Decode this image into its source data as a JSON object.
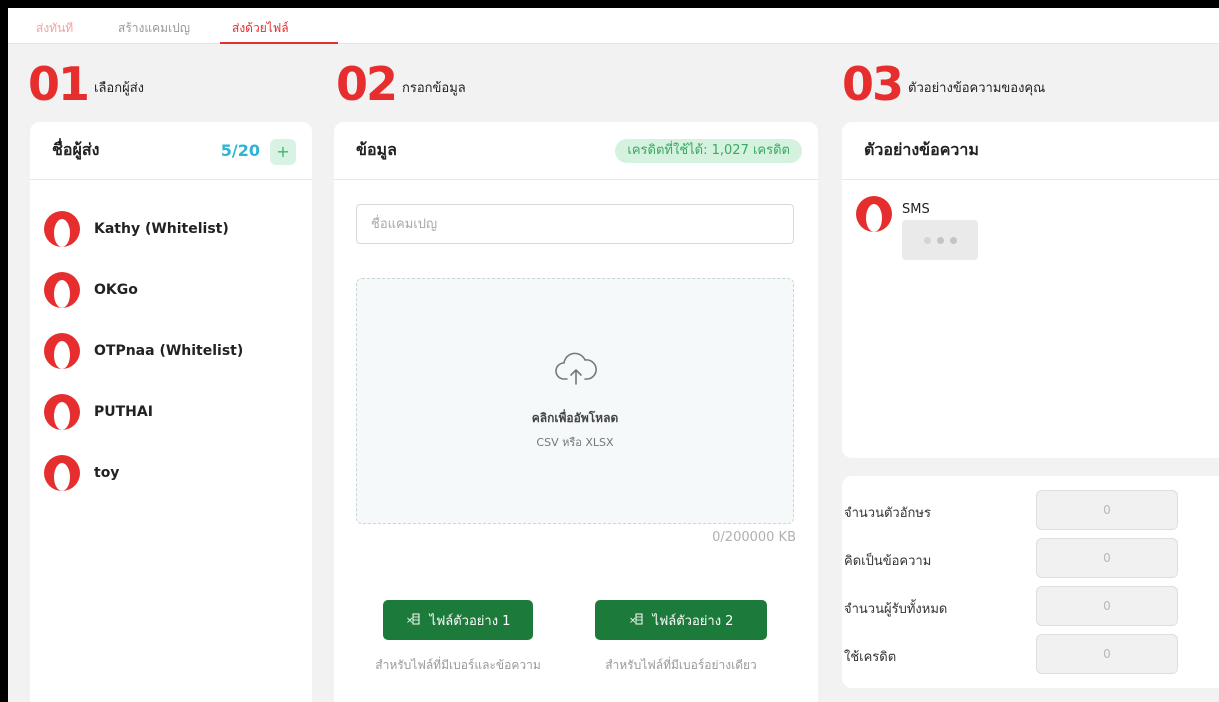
{
  "tabs": [
    {
      "label": "ส่งทันที"
    },
    {
      "label": "สร้างแคมเปญ"
    },
    {
      "label": "ส่งด้วยไฟล์"
    }
  ],
  "steps": [
    {
      "number": "01",
      "label": "เลือกผู้ส่ง"
    },
    {
      "number": "02",
      "label": "กรอกข้อมูล"
    },
    {
      "number": "03",
      "label": "ตัวอย่างข้อความของคุณ"
    }
  ],
  "sender_card": {
    "title": "ชื่อผู้ส่ง",
    "count": "5/20",
    "add_label": "+",
    "senders": [
      {
        "name": "Kathy (Whitelist)"
      },
      {
        "name": "OKGo"
      },
      {
        "name": "OTPnaa (Whitelist)"
      },
      {
        "name": "PUTHAI"
      },
      {
        "name": "toy"
      }
    ]
  },
  "form_card": {
    "title": "ข้อมูล",
    "credit_badge": "เครดิตที่ใช้ได้: 1,027 เครดิต",
    "campaign_placeholder": "ชื่อแคมเปญ",
    "upload_title": "คลิกเพื่ออัพโหลด",
    "upload_sub": "CSV หรือ XLSX",
    "file_size": "0/200000 KB",
    "download_buttons": [
      {
        "label": "ไฟล์ตัวอย่าง 1",
        "note": "สำหรับไฟล์ที่มีเบอร์และข้อความ"
      },
      {
        "label": "ไฟล์ตัวอย่าง 2",
        "note": "สำหรับไฟล์ที่มีเบอร์อย่างเดียว"
      }
    ]
  },
  "preview_card": {
    "title": "ตัวอย่างข้อความ",
    "channel": "SMS"
  },
  "stats": [
    {
      "label": "จำนวนตัวอักษร",
      "value": "0"
    },
    {
      "label": "คิดเป็นข้อความ",
      "value": "0"
    },
    {
      "label": "จำนวนผู้รับทั้งหมด",
      "value": "0"
    },
    {
      "label": "ใช้เครดิต",
      "value": "0"
    }
  ],
  "colors": {
    "accent": "#e62e2e",
    "counter": "#2bb5d6",
    "credit_badge_bg": "#d5f2df",
    "download_button": "#1c7a3a"
  },
  "icons": [
    "user-avatar-icon",
    "cloud-upload-icon",
    "excel-icon",
    "plus-icon"
  ]
}
